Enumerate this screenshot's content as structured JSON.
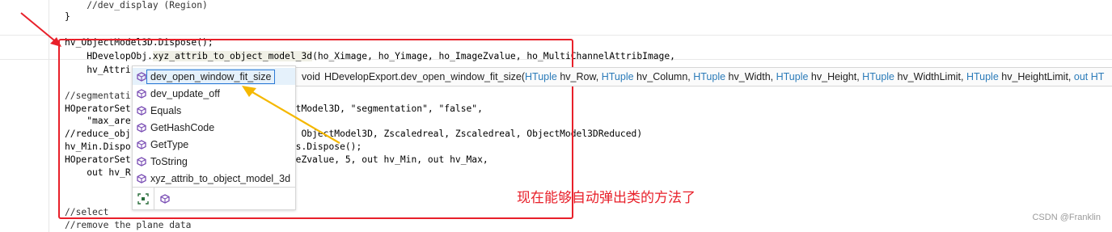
{
  "code_lines": [
    "        //dev_display (Region)",
    "    }",
    "",
    "    hv_ObjectModel3D.Dispose();",
    "    HDevelopObj.xyz_attrib_to_object_model_3d(ho_Ximage, ho_Yimage, ho_ImageZvalue, ho_MultiChannelAttribImage,",
    "        hv_Attri",
    "",
    "    //segmentati",
    "    HOperatorSet                            ectModel3D, \"segmentation\", \"false\",",
    "        \"max_are",
    "    //reduce_obj                            e, ObjectModel3D, Zscaledreal, Zscaledreal, ObjectModel3DReduced)",
    "    hv_Min.Dispo                            ngs.Dispose();",
    "    HOperatorSet                            ageZvalue, 5, out hv_Min, out hv_Max,",
    "        out hv_R",
    "",
    "",
    "    //select",
    "    //remove the plane data"
  ],
  "highlighted_method": "xyz_attrib_to_object_model_3d",
  "completion": {
    "items": [
      {
        "label": "dev_open_window_fit_size",
        "selected": true
      },
      {
        "label": "dev_update_off",
        "selected": false
      },
      {
        "label": "Equals",
        "selected": false
      },
      {
        "label": "GetHashCode",
        "selected": false
      },
      {
        "label": "GetType",
        "selected": false
      },
      {
        "label": "ToString",
        "selected": false
      },
      {
        "label": "xyz_attrib_to_object_model_3d",
        "selected": false
      }
    ],
    "icon": "method-cube-icon",
    "icon_color": "#7b4fb5"
  },
  "signature": {
    "return_type": "void",
    "method": "HDevelopExport.dev_open_window_fit_size(",
    "params": [
      {
        "type": "HTuple",
        "name": "hv_Row"
      },
      {
        "type": "HTuple",
        "name": "hv_Column"
      },
      {
        "type": "HTuple",
        "name": "hv_Width"
      },
      {
        "type": "HTuple",
        "name": "hv_Height"
      },
      {
        "type": "HTuple",
        "name": "hv_WidthLimit"
      },
      {
        "type": "HTuple",
        "name": "hv_HeightLimit"
      },
      {
        "type": "out HT",
        "name": ""
      }
    ]
  },
  "annotation_text": "现在能够自动弹出类的方法了",
  "annotation_color": "#e8202a",
  "watermark": "CSDN @Franklin"
}
